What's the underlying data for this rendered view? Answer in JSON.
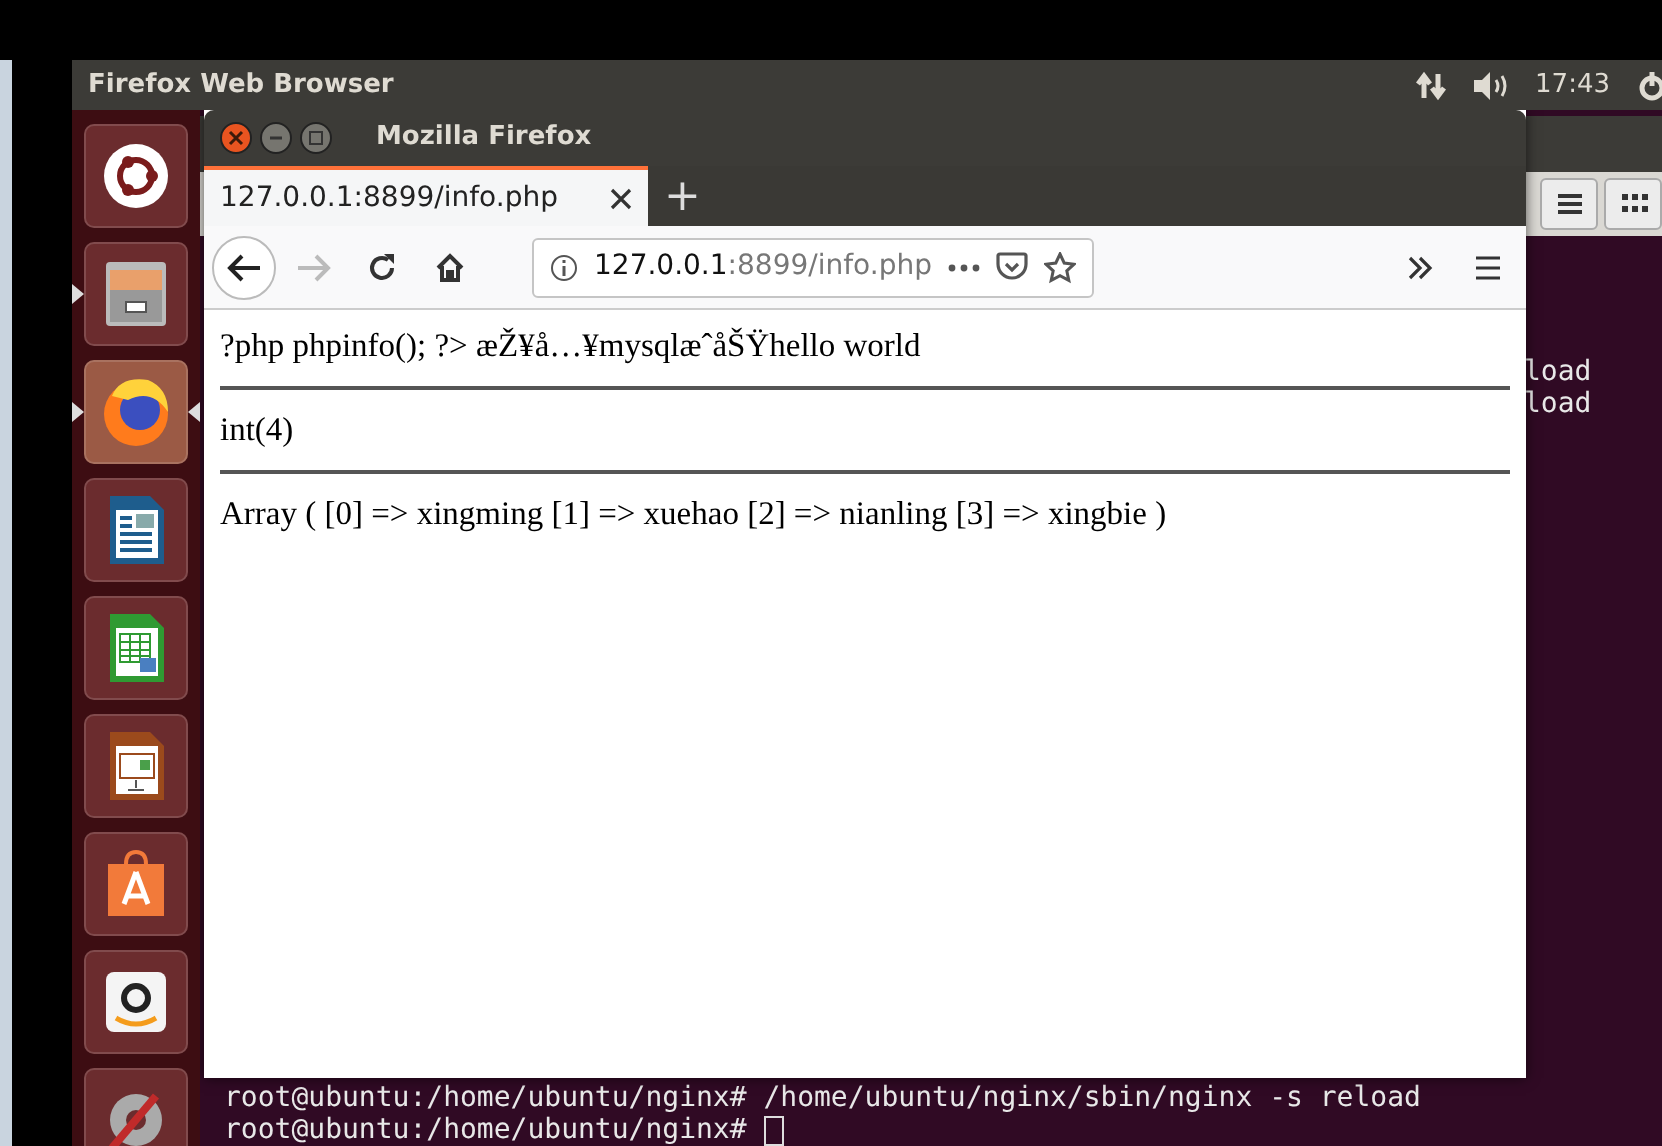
{
  "top_panel": {
    "app_title": "Firefox Web Browser",
    "clock": "17:43"
  },
  "launcher": [
    {
      "kind": "ubuntu",
      "running": false,
      "focused": false
    },
    {
      "kind": "files",
      "running": true,
      "focused": false
    },
    {
      "kind": "firefox",
      "running": true,
      "focused": true
    },
    {
      "kind": "writer",
      "running": false,
      "focused": false
    },
    {
      "kind": "calc",
      "running": false,
      "focused": false
    },
    {
      "kind": "impress",
      "running": false,
      "focused": false
    },
    {
      "kind": "software",
      "running": false,
      "focused": false
    },
    {
      "kind": "amazon",
      "running": false,
      "focused": false
    },
    {
      "kind": "settings",
      "running": false,
      "focused": false
    }
  ],
  "browser": {
    "window_title": "Mozilla Firefox",
    "tabs": [
      {
        "label": "127.0.0.1:8899/info.php",
        "selected": true
      }
    ],
    "new_tab": "+",
    "address": {
      "host": "127.0.0.1",
      "rest": ":8899/info.php"
    },
    "page_lines": [
      "?php phpinfo(); ?> æŽ¥å…¥mysqlæˆåŠŸhello world",
      "int(4)",
      "Array ( [0] => xingming [1] => xuehao [2] => nianling [3] => xingbie )"
    ]
  },
  "terminal": {
    "right_fragments": [
      "load",
      "load"
    ],
    "bottom_lines": [
      "root@ubuntu:/home/ubuntu/nginx# /home/ubuntu/nginx/sbin/nginx -s reload",
      "root@ubuntu:/home/ubuntu/nginx# "
    ]
  }
}
